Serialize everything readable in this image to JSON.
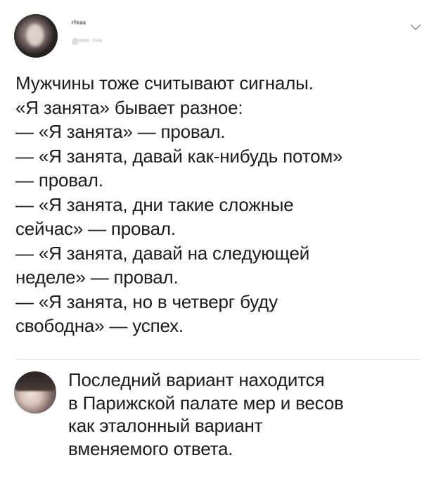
{
  "tweet": {
    "author_name": "ʳᶠᵉᵃᵃ",
    "author_handle": "@ʸᵉᵉᵗ ʳʳᵘᵃ",
    "lines": [
      "Мужчины тоже считывают сигналы.",
      "«Я занята» бывает разное:",
      "— «Я занята» — провал.",
      "— «Я занята, давай как-нибудь потом»",
      "— провал.",
      "— «Я занята, дни такие сложные",
      "сейчас» — провал.",
      "— «Я занята, давай на следующей",
      "неделе» — провал.",
      "— «Я занята, но в четверг буду",
      "свободна» — успех."
    ]
  },
  "reply": {
    "lines": [
      "Последний вариант находится",
      "в Парижской палате мер и весов",
      "как эталонный вариант",
      "вменяемого ответа."
    ]
  },
  "icons": {
    "menu": "chevron-down-icon"
  }
}
